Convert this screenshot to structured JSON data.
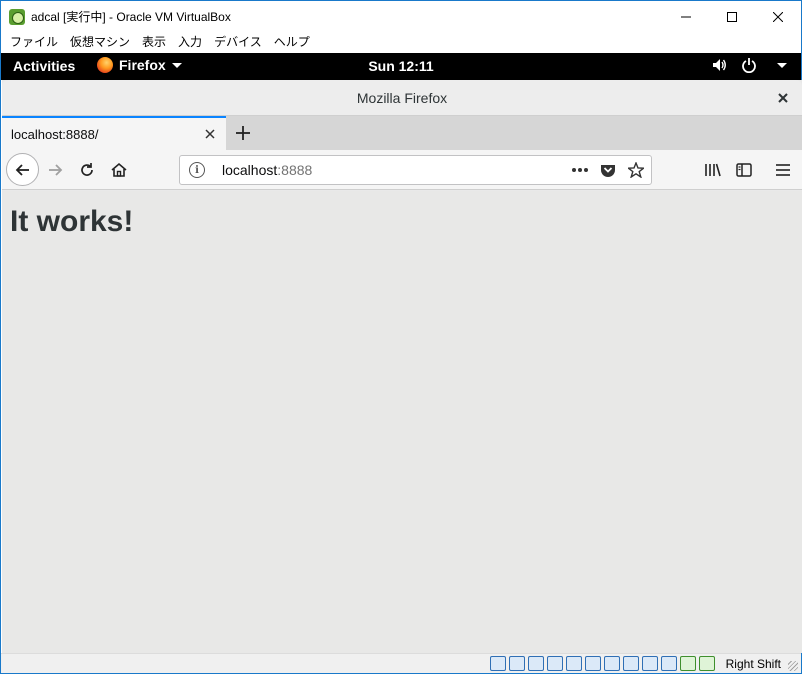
{
  "vbox": {
    "title": "adcal [実行中] - Oracle VM VirtualBox",
    "menu": [
      "ファイル",
      "仮想マシン",
      "表示",
      "入力",
      "デバイス",
      "ヘルプ"
    ],
    "status": {
      "host_key": "Right Shift",
      "icons": [
        "optical-drive-icon",
        "audio-icon",
        "network-icon",
        "usb-icon",
        "shared-folders-icon",
        "display-icon",
        "capture-icon",
        "video-capture-icon",
        "mouse-integration-icon",
        "guest-additions-icon",
        "cpu-icon",
        "keyboard-icon"
      ]
    }
  },
  "gnome": {
    "activities": "Activities",
    "app_name": "Firefox",
    "clock": "Sun 12:11"
  },
  "firefox": {
    "window_title": "Mozilla Firefox",
    "tab_title": "localhost:8888/",
    "url_host": "localhost",
    "url_port": ":8888"
  },
  "page": {
    "heading": "It works!"
  },
  "colors": {
    "tab_accent": "#0a84ff",
    "gnome_bar": "#000000",
    "window_border": "#1979ca"
  }
}
